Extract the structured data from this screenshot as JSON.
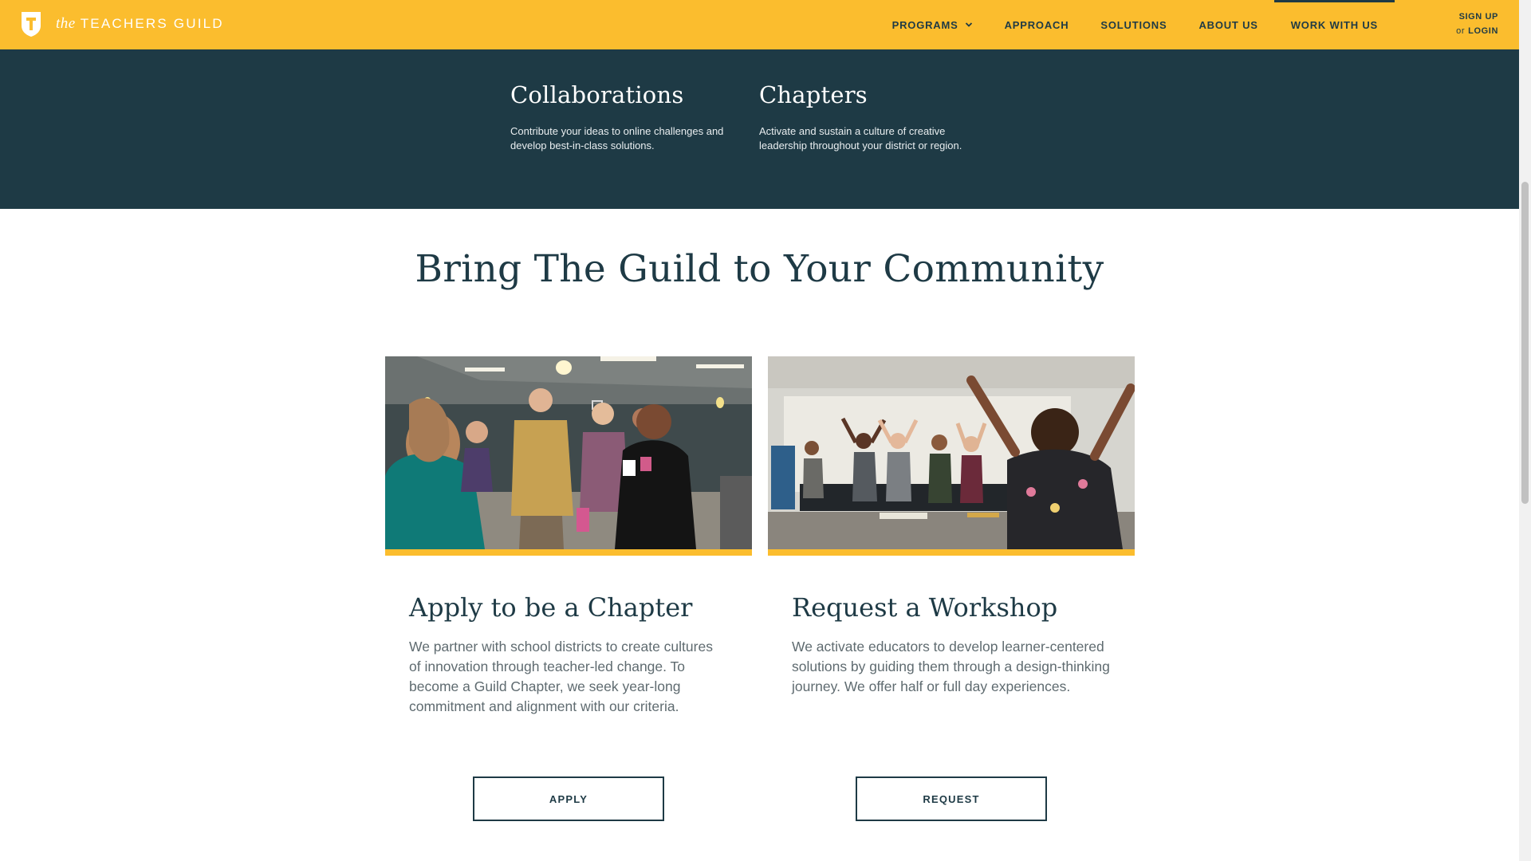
{
  "header": {
    "logo_prefix": "the",
    "logo_name": "TEACHERS GUILD",
    "nav": [
      {
        "label": "PROGRAMS"
      },
      {
        "label": "APPROACH"
      },
      {
        "label": "SOLUTIONS"
      },
      {
        "label": "ABOUT US"
      },
      {
        "label": "WORK WITH US"
      }
    ],
    "signup_label": "SIGN UP",
    "or_label": "or",
    "login_label": "LOGIN"
  },
  "programs": [
    {
      "title": "Collaborations",
      "text": "Contribute your ideas to online challenges and develop best-in-class solutions."
    },
    {
      "title": "Chapters",
      "text": "Activate and sustain a culture of creative leadership throughout your district or region."
    }
  ],
  "community": {
    "title": "Bring The Guild to Your Community",
    "cards": [
      {
        "title": "Apply to be a Chapter",
        "text": "We partner with school districts to create cultures of innovation through teacher-led change. To become a Guild Chapter, we seek year-long commitment and alignment with our criteria.",
        "button": "APPLY"
      },
      {
        "title": "Request a Workshop",
        "text": "We activate educators to develop learner-centered solutions by guiding them through a design-thinking journey. We offer half or full day experiences.",
        "button": "REQUEST"
      }
    ]
  },
  "colors": {
    "brand_yellow": "#fbbd2e",
    "brand_navy": "#1e3a45",
    "body_text": "#5f6b70"
  }
}
